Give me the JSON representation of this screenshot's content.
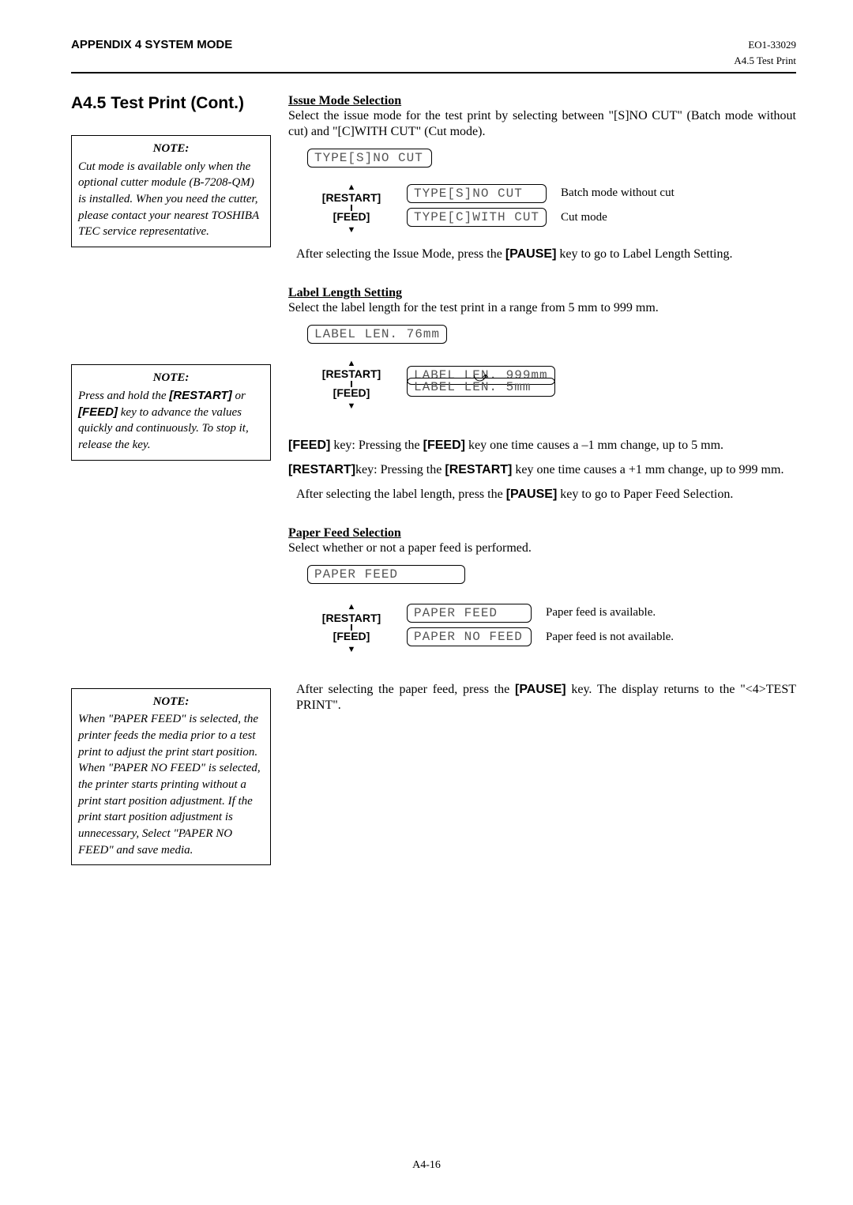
{
  "header": {
    "left": "APPENDIX 4 SYSTEM MODE",
    "right": "EO1-33029",
    "sub": "A4.5 Test Print"
  },
  "section_title": "A4.5  Test Print  (Cont.)",
  "notes": {
    "n1_title": "NOTE:",
    "n1_body": "Cut mode is available only when the optional cutter module (B-7208-QM) is installed.  When you need the cutter, please contact your nearest TOSHIBA TEC service representative.",
    "n2_title": "NOTE:",
    "n2_body_pre": "Press and hold the ",
    "n2_key1": "[RESTART]",
    "n2_body_mid": " or ",
    "n2_key2": "[FEED]",
    "n2_body_post": " key to advance the values quickly and continuously.  To stop it, release the key.",
    "n3_title": "NOTE:",
    "n3_body": "When \"PAPER FEED\" is selected, the printer feeds the media prior to a test print to adjust the print start position. When \"PAPER NO FEED\" is selected, the printer starts printing without a print start position adjustment.  If the print start position adjustment is unnecessary, Select \"PAPER NO FEED\" and save media."
  },
  "issue": {
    "title": "Issue Mode Selection",
    "intro": "Select the issue mode for the test print by selecting between \"[S]NO CUT\" (Batch mode without cut) and \"[C]WITH CUT\" (Cut mode).",
    "lcd0": "TYPE[S]NO CUT",
    "restart": "[RESTART]",
    "feed": "[FEED]",
    "lcd1": "TYPE[S]NO CUT",
    "lcd2": "TYPE[C]WITH CUT",
    "cap1": "Batch mode without cut",
    "cap2": "Cut mode",
    "after_pre": "After selecting the Issue Mode, press the ",
    "after_key": "[PAUSE]",
    "after_post": " key to go to Label Length Setting."
  },
  "label": {
    "title": "Label Length Setting",
    "intro": "Select the label length for the test print in a range from 5 mm to 999 mm.",
    "lcd0": "LABEL LEN.  76mm",
    "restart": "[RESTART]",
    "feed": "[FEED]",
    "lcd1": "LABEL LEN. 999mm",
    "lcd2": "LABEL LEN.   5mm",
    "body1_k1": "[FEED]",
    "body1_t1": " key: Pressing the ",
    "body1_k2": "[FEED]",
    "body1_t2": " key one time causes a –1 mm change, up to 5 mm.",
    "body2_k1": "[RESTART]",
    "body2_t1": "key: Pressing the ",
    "body2_k2": "[RESTART]",
    "body2_t2": " key one time causes a +1 mm change, up to 999 mm.",
    "after_pre": "After selecting the label length, press the ",
    "after_key": "[PAUSE]",
    "after_post": " key to go to Paper Feed Selection."
  },
  "paper": {
    "title": "Paper Feed Selection",
    "intro": "Select whether or not a paper feed is performed.",
    "lcd0": "PAPER FEED",
    "restart": "[RESTART]",
    "feed": "[FEED]",
    "lcd1": "PAPER FEED",
    "lcd2": "PAPER NO FEED",
    "cap1": "Paper feed is available.",
    "cap2": "Paper feed is not available.",
    "after_pre": "After selecting the paper feed, press the ",
    "after_key": "[PAUSE]",
    "after_post": " key.  The display returns to the \"<4>TEST PRINT\"."
  },
  "footer": "A4-16"
}
